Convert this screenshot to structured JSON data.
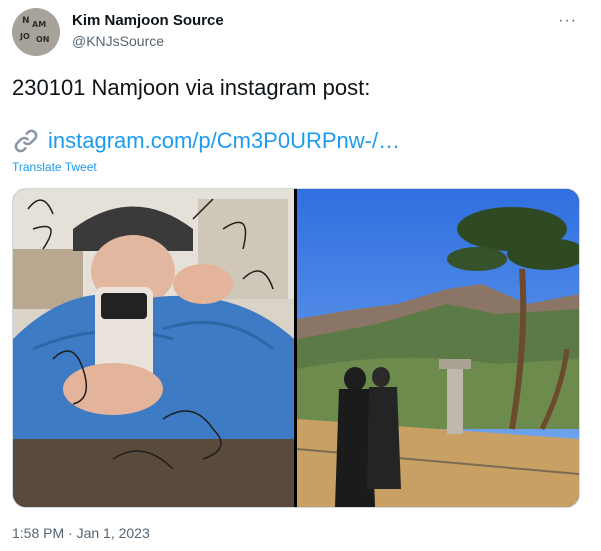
{
  "tweet": {
    "author_name": "Kim Namjoon Source",
    "author_handle": "@KNJsSource",
    "avatar_letters": [
      "N",
      "AM",
      "JO",
      "ON"
    ],
    "text": "230101 Namjoon via instagram post:",
    "link_text": "instagram.com/p/Cm3P0URPnw-/…",
    "translate_label": "Translate Tweet",
    "timestamp": "1:58 PM · Jan 1, 2023",
    "more_icon": "···"
  },
  "icons": {
    "link": "link-icon",
    "more": "ellipsis-icon"
  },
  "colors": {
    "link": "#1d9bf0",
    "primary_text": "#0f1419",
    "secondary_text": "#536471",
    "border": "#cfd9de"
  }
}
